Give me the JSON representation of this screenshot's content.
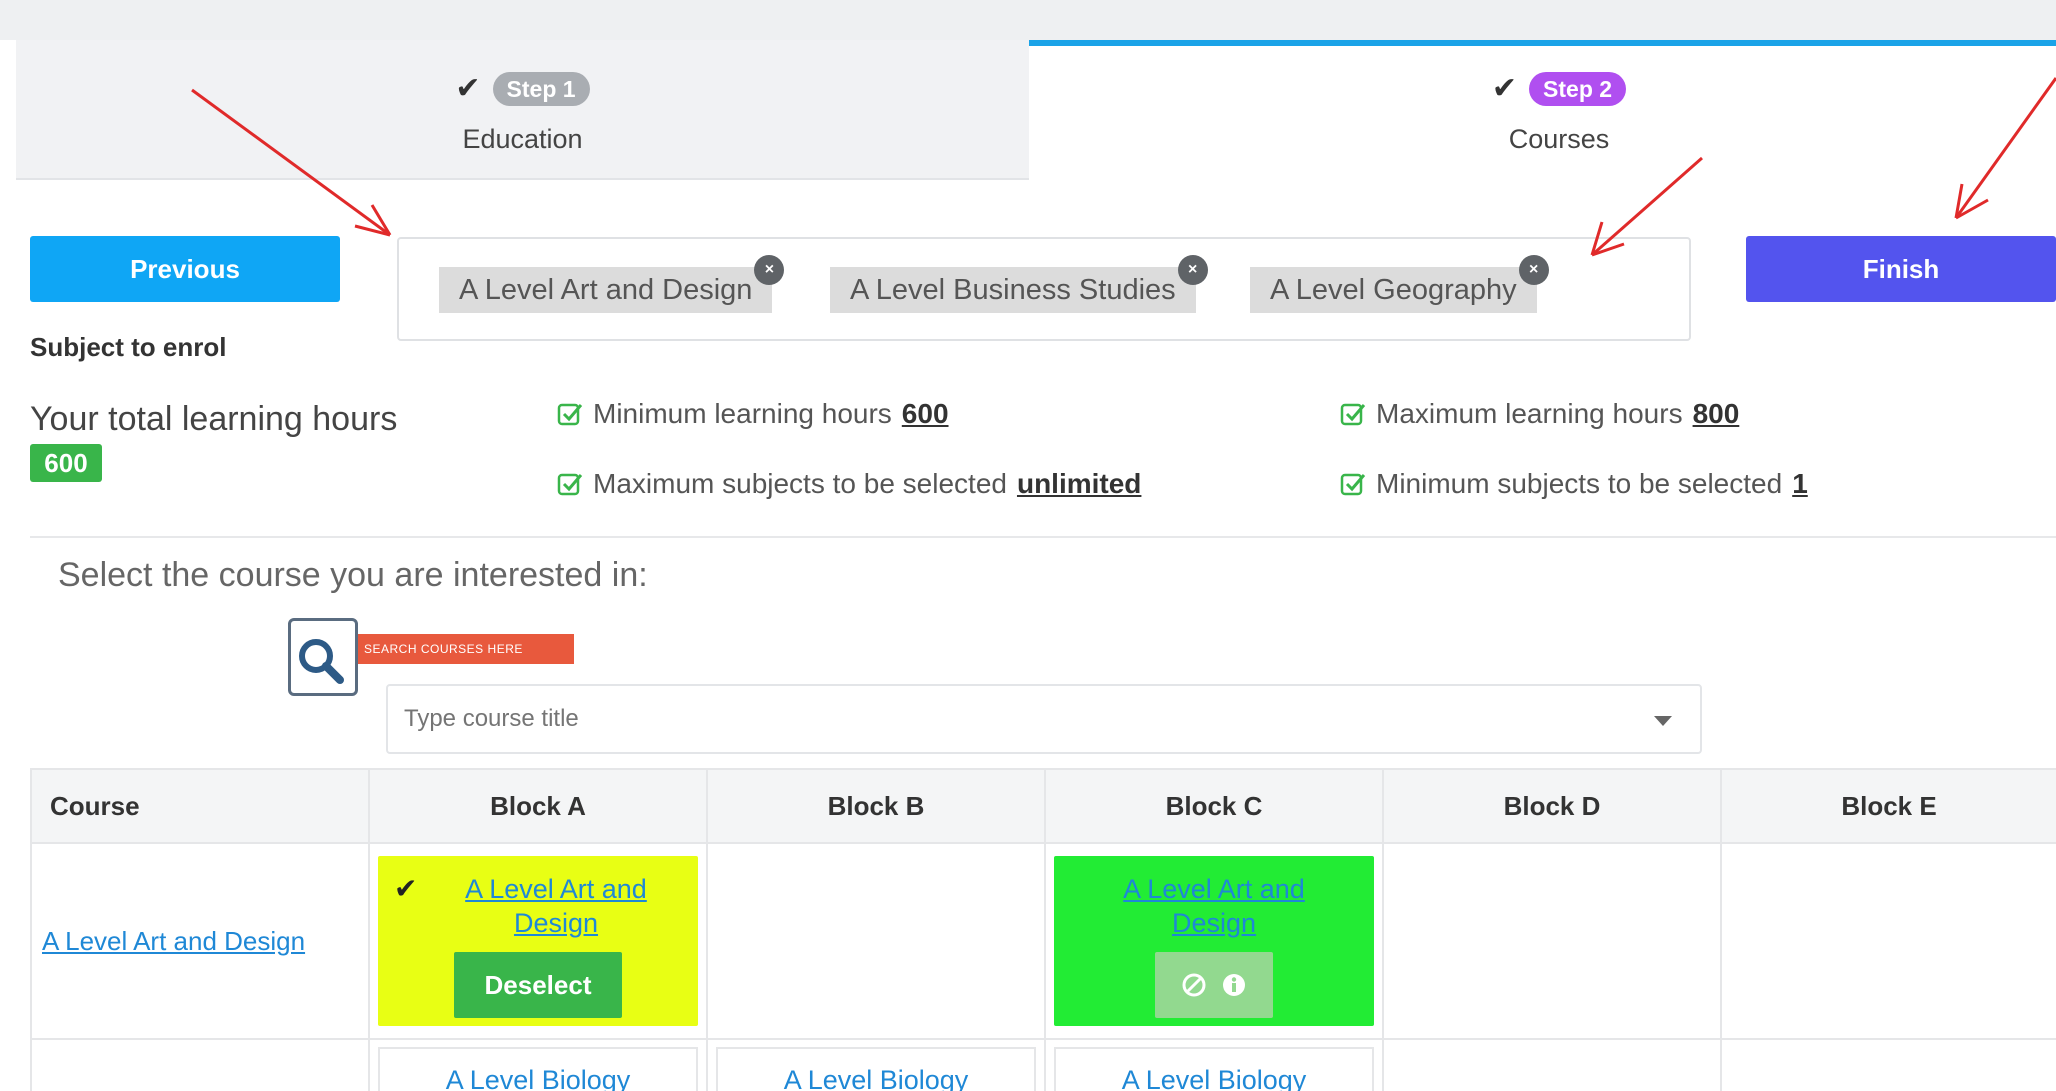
{
  "wizard": {
    "steps": [
      {
        "badge": "Step 1",
        "label": "Education",
        "state": "completed"
      },
      {
        "badge": "Step 2",
        "label": "Courses",
        "state": "active"
      }
    ]
  },
  "actions": {
    "previous_label": "Previous",
    "finish_label": "Finish"
  },
  "selected_subjects": [
    "A Level Art and Design",
    "A Level Business Studies",
    "A Level Geography"
  ],
  "remove_chip_glyph": "×",
  "enrol": {
    "subject_label": "Subject to enrol",
    "hours_label": "Your total learning hours",
    "hours_value": "600"
  },
  "rules": [
    {
      "text": "Minimum learning hours",
      "value": "600"
    },
    {
      "text": "Maximum learning hours",
      "value": "800"
    },
    {
      "text": "Maximum subjects to be selected",
      "value": "unlimited"
    },
    {
      "text": "Minimum subjects to be selected",
      "value": "1"
    }
  ],
  "search": {
    "heading": "Select the course you are interested in:",
    "banner_text": "SEARCH COURSES HERE",
    "placeholder": "Type course title"
  },
  "table": {
    "headers": [
      "Course",
      "Block A",
      "Block B",
      "Block C",
      "Block D",
      "Block E"
    ],
    "rows": [
      {
        "course": "A Level Art and Design",
        "block_a": {
          "title": "A Level Art and Design",
          "button": "Deselect"
        },
        "block_c": {
          "title": "A Level Art and Design"
        }
      },
      {
        "course": "",
        "block_a": {
          "title": "A Level Biology"
        },
        "block_b": {
          "title": "A Level Biology"
        },
        "block_c": {
          "title": "A Level Biology"
        }
      }
    ]
  },
  "colors": {
    "previous": "#0fa6f5",
    "finish": "#5354ee",
    "step1_pill": "#a9adb2",
    "step2_pill": "#b04ff0",
    "selected_card": "#e8ff14",
    "available_card": "#22ec34",
    "deselect": "#39b54a",
    "hours_badge": "#39b54a",
    "annotation_arrow": "#e02a2a"
  },
  "icons": [
    "check-icon",
    "close-icon",
    "checkbox-checked-icon",
    "search-icon",
    "chevron-down-icon",
    "ban-icon",
    "info-icon"
  ]
}
